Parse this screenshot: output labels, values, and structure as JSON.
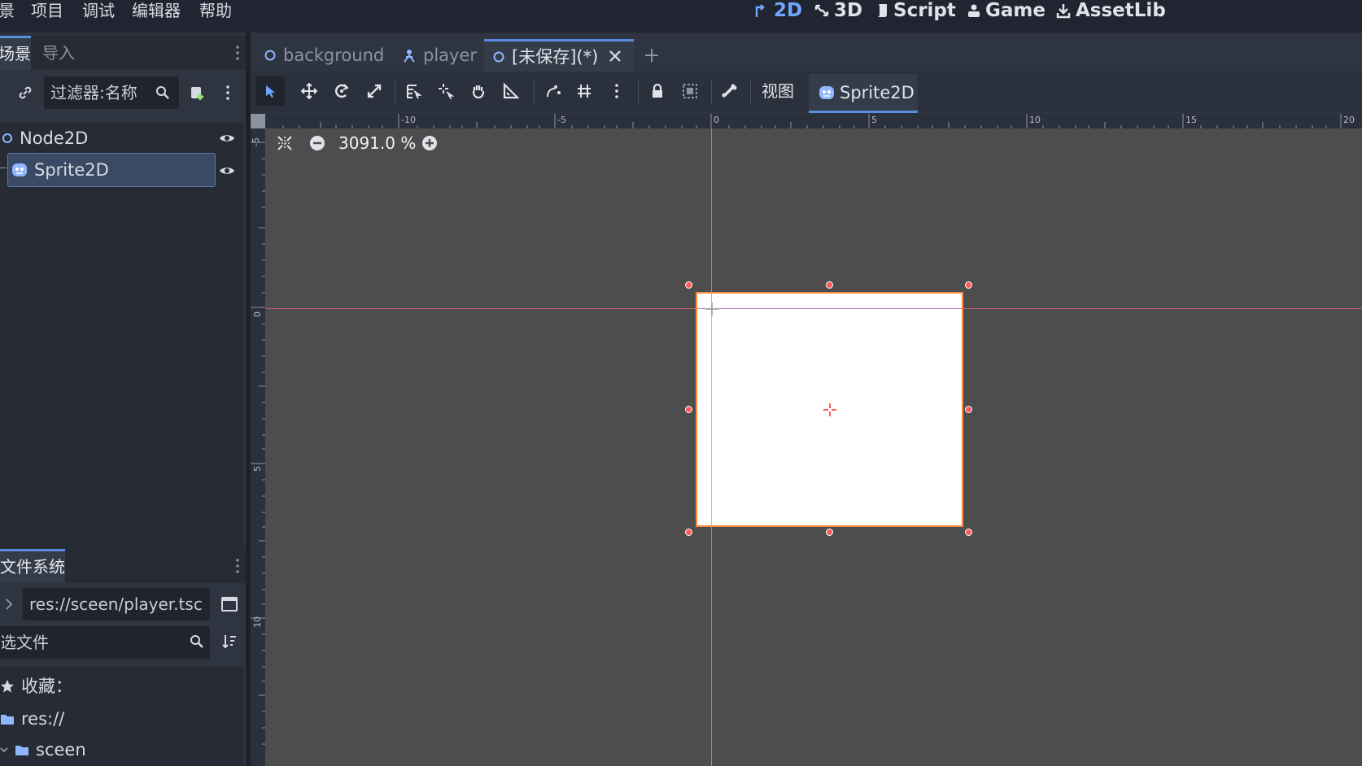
{
  "menu": {
    "scene": "场景",
    "project": "项目",
    "debug": "调试",
    "editor": "编辑器",
    "help": "帮助"
  },
  "workspaces": [
    {
      "label": "2D",
      "icon": "2d-icon",
      "active": true
    },
    {
      "label": "3D",
      "icon": "3d-icon",
      "active": false
    },
    {
      "label": "Script",
      "icon": "script-icon",
      "active": false
    },
    {
      "label": "Game",
      "icon": "game-icon",
      "active": false
    },
    {
      "label": "AssetLib",
      "icon": "assetlib-icon",
      "active": false
    }
  ],
  "scene_dock": {
    "tabs": [
      "场景",
      "导入"
    ],
    "filter_placeholder": "过滤器:名称",
    "tree": [
      {
        "name": "Node2D",
        "icon": "node2d-icon"
      },
      {
        "name": "Sprite2D",
        "icon": "sprite2d-icon",
        "selected": true
      }
    ]
  },
  "filesystem_dock": {
    "tab": "文件系统",
    "path": "res://sceen/player.tsc",
    "filter_placeholder": "筛选文件",
    "favorites_label": "收藏：",
    "items": [
      {
        "name": "res://",
        "icon": "folder-icon"
      },
      {
        "name": "sceen",
        "icon": "folder-icon"
      }
    ]
  },
  "scene_tabs": [
    {
      "label": "background",
      "icon": "node-circle-icon",
      "active": false
    },
    {
      "label": "player",
      "icon": "player-icon",
      "active": false
    },
    {
      "label": "[未保存](*)",
      "icon": "node-circle-icon",
      "active": true
    }
  ],
  "toolbar": {
    "view_label": "视图",
    "sprite_label": "Sprite2D",
    "tools": [
      "select-tool-icon",
      "move-tool-icon",
      "rotate-tool-icon",
      "scale-tool-icon",
      "list-select-icon",
      "pivot-tool-icon",
      "pan-tool-icon",
      "ruler-tool-icon",
      "smart-snap-icon",
      "grid-snap-icon",
      "more-options-icon",
      "lock-icon",
      "group-icon",
      "bone-icon"
    ]
  },
  "viewport": {
    "zoom": "3091.0 %",
    "ruler_h": [
      "-10",
      "-5",
      "0",
      "5",
      "10",
      "15",
      "20"
    ],
    "ruler_v": [
      "-5",
      "0",
      "5",
      "10"
    ]
  },
  "colors": {
    "accent": "#6fa8ff",
    "selection": "#ff8a3d",
    "handle": "#ff5a5a",
    "viewport_bg": "#4d4d4d"
  }
}
